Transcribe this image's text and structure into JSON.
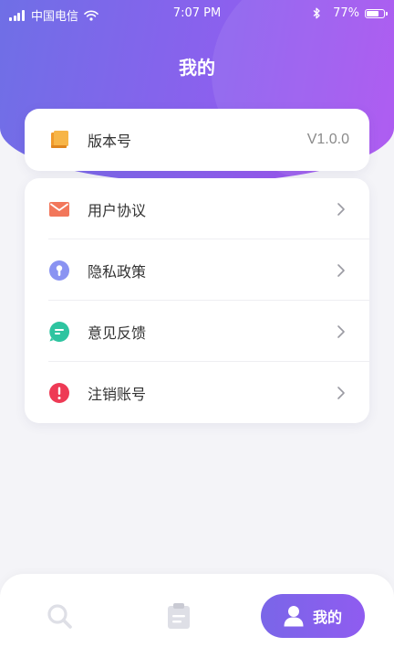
{
  "status_bar": {
    "carrier": "中国电信",
    "time": "7:07 PM",
    "battery_percent": "77%",
    "battery_level": 0.77,
    "signal_bars": 4
  },
  "header": {
    "title": "我的",
    "gradient_colors": [
      "#6f6fe6",
      "#a94ff0"
    ]
  },
  "version_card": {
    "icon": "book-icon",
    "label": "版本号",
    "value": "V1.0.0"
  },
  "menu": {
    "items": [
      {
        "icon": "mail-icon",
        "label": "用户协议",
        "color": "#f2775b"
      },
      {
        "icon": "lock-icon",
        "label": "隐私政策",
        "color": "#8a93f2"
      },
      {
        "icon": "chat-icon",
        "label": "意见反馈",
        "color": "#2ec4a0"
      },
      {
        "icon": "alert-icon",
        "label": "注销账号",
        "color": "#ee3a55"
      }
    ]
  },
  "bottom_nav": {
    "items": [
      {
        "icon": "search-icon"
      },
      {
        "icon": "clipboard-icon"
      },
      {
        "icon": "person-icon",
        "label": "我的",
        "active": true
      }
    ],
    "active_color": "#8060ec"
  }
}
